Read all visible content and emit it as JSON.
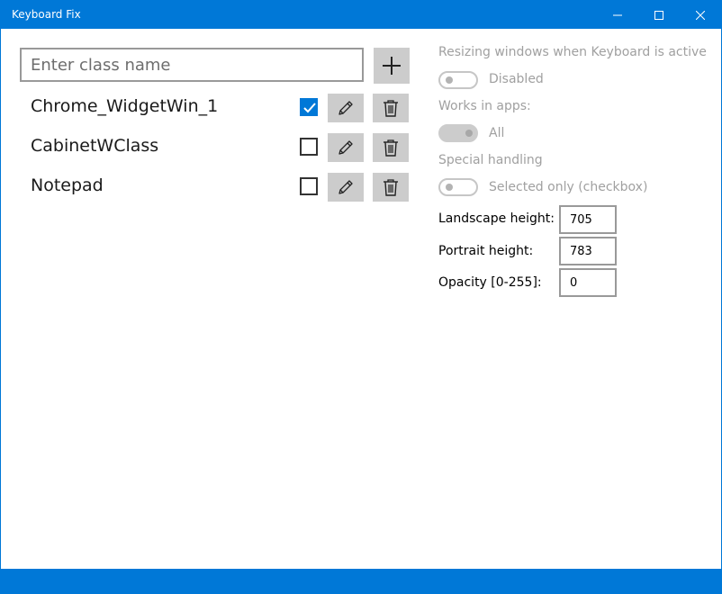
{
  "window": {
    "title": "Keyboard Fix",
    "accent": "#0078d7"
  },
  "class_input": {
    "value": "",
    "placeholder": "Enter class name"
  },
  "entries": [
    {
      "name": "Chrome_WidgetWin_1",
      "checked": true
    },
    {
      "name": "CabinetWClass",
      "checked": false
    },
    {
      "name": "Notepad",
      "checked": false
    }
  ],
  "settings": {
    "resizing_label": "Resizing windows when Keyboard is active",
    "resizing_toggle": {
      "state": "off",
      "text": "Disabled"
    },
    "works_in_label": "Works in apps:",
    "works_in_toggle": {
      "state": "on",
      "text": "All"
    },
    "special_label": "Special handling",
    "special_toggle": {
      "state": "off",
      "text": "Selected only (checkbox)"
    },
    "landscape_label": "Landscape height:",
    "landscape_value": "705",
    "portrait_label": "Portrait height:",
    "portrait_value": "783",
    "opacity_label": "Opacity [0-255]:",
    "opacity_value": "0"
  },
  "icons": {
    "minimize": "minimize-icon",
    "maximize": "maximize-icon",
    "close": "close-icon",
    "add": "plus-icon",
    "edit": "pencil-icon",
    "delete": "trash-icon",
    "check": "checkmark-icon"
  }
}
